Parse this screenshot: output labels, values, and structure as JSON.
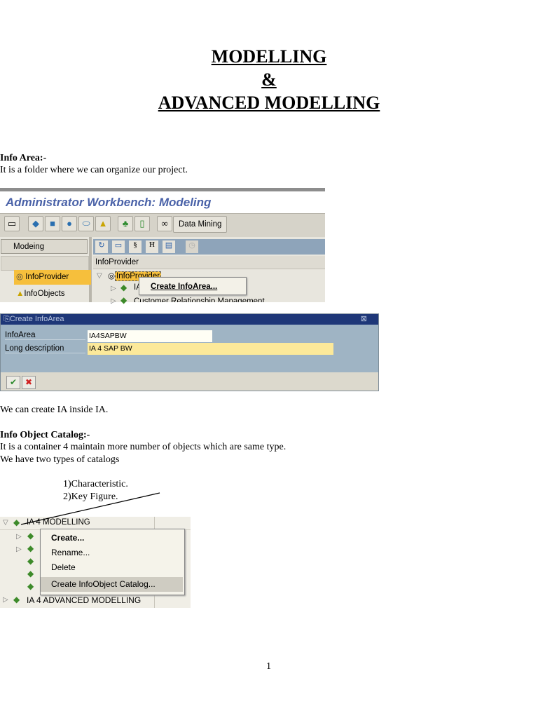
{
  "title": {
    "line1": "MODELLING",
    "line2": "&",
    "line3": "ADVANCED MODELLING"
  },
  "info_area": {
    "heading": "Info Area:-",
    "text": "It is a folder where we can organize our project."
  },
  "awb": {
    "window_title": "Administrator Workbench: Modeling",
    "data_mining_button": "Data Mining",
    "left_button": "Modeing",
    "nav_items": [
      "InfoProvider",
      "InfoObjects"
    ],
    "tree_header": "InfoProvider",
    "tree_root": "InfoProvider",
    "tree_child_1": "IA",
    "tree_child_2": "Customer Relationship Management",
    "context_menu_item": "Create InfoArea..."
  },
  "dialog": {
    "title": "Create InfoArea",
    "fields": [
      {
        "label": "InfoArea",
        "value": "IA4SAPBW"
      },
      {
        "label": "Long description",
        "value": "IA 4 SAP BW"
      }
    ],
    "ok_icon": "check-icon",
    "cancel_icon": "cancel-icon"
  },
  "ia_inside": "We can create IA inside IA.",
  "catalog": {
    "heading": "Info Object Catalog:-",
    "line1": "It is a container 4 maintain more number of objects which are same type.",
    "line2": "We have two types of catalogs",
    "types": [
      "1)Characteristic.",
      "2)Key Figure."
    ]
  },
  "tree2": {
    "root": "IA 4 MODELLING",
    "bottom": "IA 4 ADVANCED MODELLING",
    "menu": [
      "Create...",
      "Rename...",
      "Delete",
      "Create InfoObject Catalog..."
    ]
  },
  "page_number": "1"
}
